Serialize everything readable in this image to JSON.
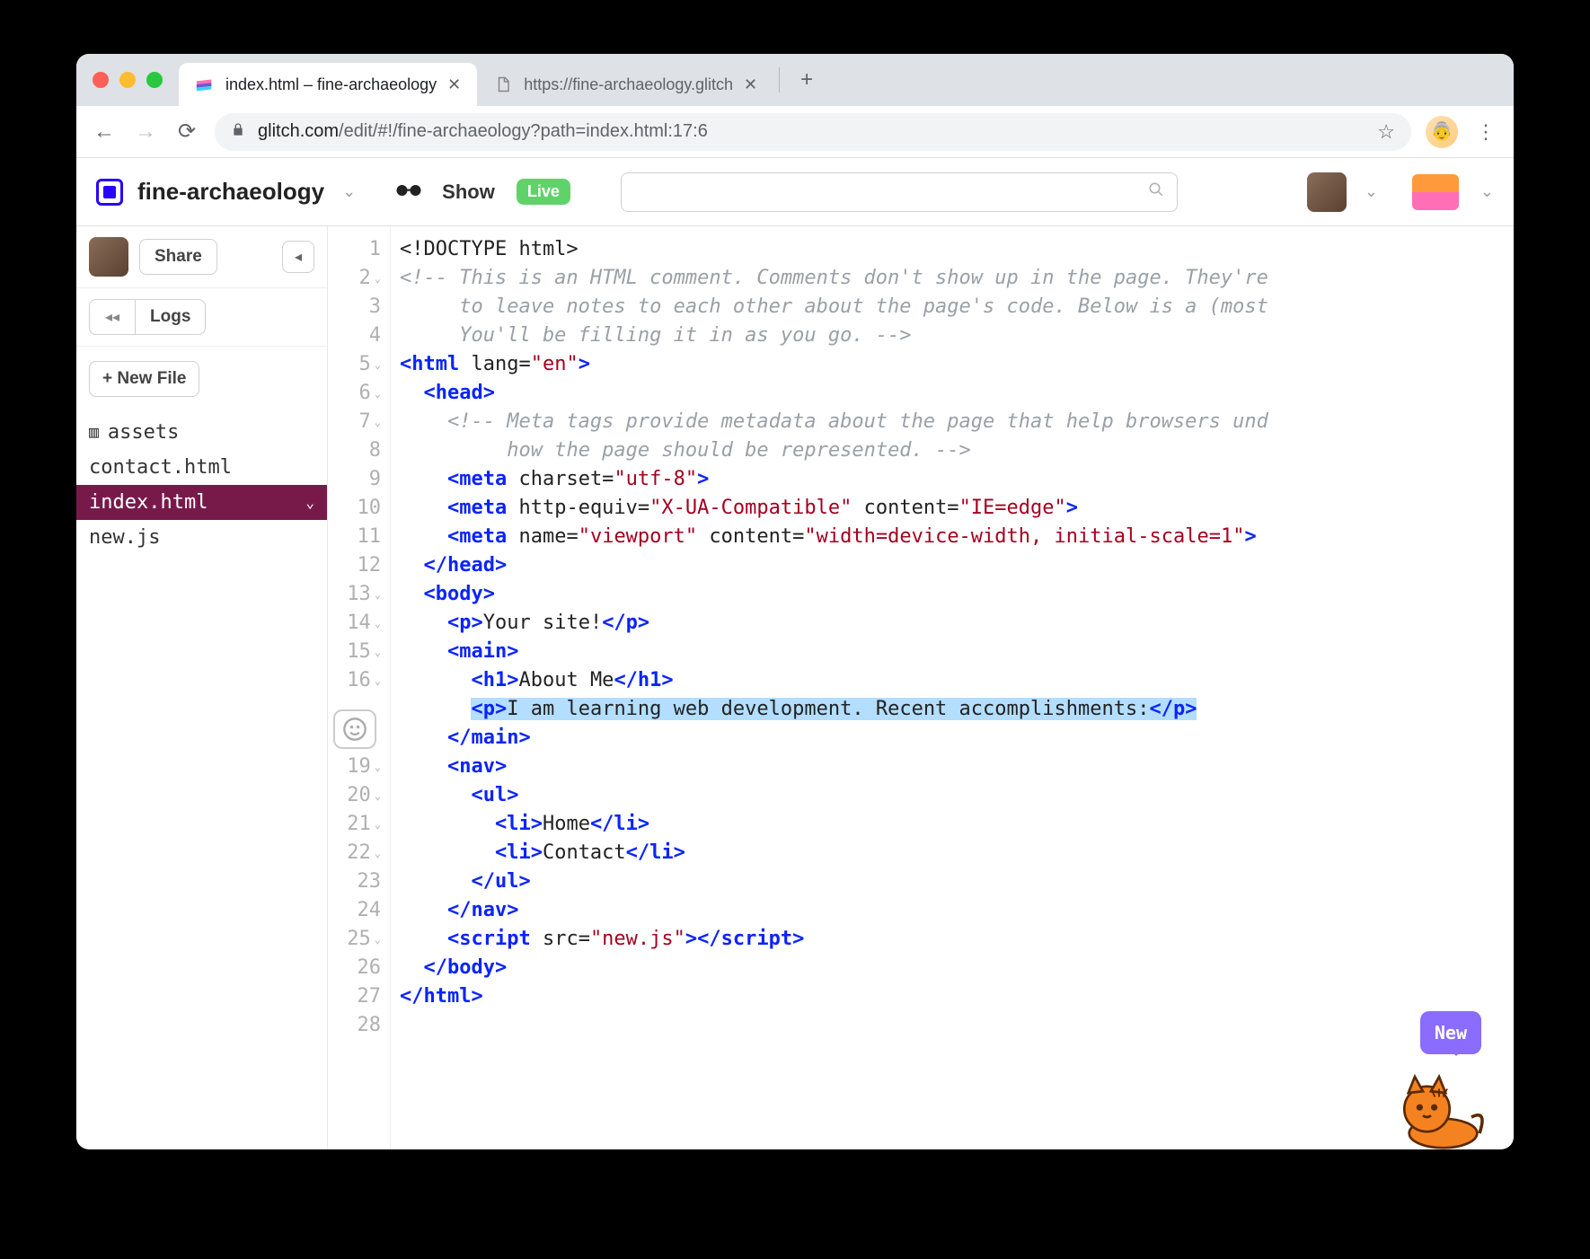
{
  "browser": {
    "tabs": [
      {
        "title": "index.html – fine-archaeology",
        "active": true
      },
      {
        "title": "https://fine-archaeology.glitch",
        "active": false
      }
    ],
    "url_domain": "glitch.com",
    "url_path": "/edit/#!/fine-archaeology?path=index.html:17:6"
  },
  "header": {
    "project_name": "fine-archaeology",
    "show_label": "Show",
    "live_label": "Live",
    "search_placeholder": ""
  },
  "sidebar": {
    "share_label": "Share",
    "logs_label": "Logs",
    "new_file_label": "+ New File",
    "files": [
      {
        "name": "assets",
        "icon": true,
        "active": false
      },
      {
        "name": "contact.html",
        "icon": false,
        "active": false
      },
      {
        "name": "index.html",
        "icon": false,
        "active": true
      },
      {
        "name": "new.js",
        "icon": false,
        "active": false
      }
    ]
  },
  "editor": {
    "lines": [
      {
        "n": 1,
        "fold": false,
        "html": "<span class='c-text'>&lt;!DOCTYPE html&gt;</span>"
      },
      {
        "n": 2,
        "fold": true,
        "html": "<span class='c-comment'>&lt;!-- This is an HTML comment. Comments don't show up in the page. They're</span>"
      },
      {
        "n": 3,
        "fold": false,
        "html": "<span class='c-comment'>     to leave notes to each other about the page's code. Below is a (most</span>"
      },
      {
        "n": 4,
        "fold": false,
        "html": "<span class='c-comment'>     You'll be filling it in as you go. --&gt;</span>"
      },
      {
        "n": 5,
        "fold": true,
        "html": "<span class='c-tag'>&lt;html</span> <span class='c-attr'>lang=</span><span class='c-str'>\"en\"</span><span class='c-tag'>&gt;</span>"
      },
      {
        "n": 6,
        "fold": true,
        "html": "  <span class='c-tag'>&lt;head&gt;</span>"
      },
      {
        "n": 7,
        "fold": true,
        "html": "    <span class='c-comment'>&lt;!-- Meta tags provide metadata about the page that help browsers und</span>"
      },
      {
        "n": 8,
        "fold": false,
        "html": "         <span class='c-comment'>how the page should be represented. --&gt;</span>"
      },
      {
        "n": 9,
        "fold": false,
        "html": "    <span class='c-tag'>&lt;meta</span> <span class='c-attr'>charset=</span><span class='c-str'>\"utf-8\"</span><span class='c-tag'>&gt;</span>"
      },
      {
        "n": 10,
        "fold": false,
        "html": "    <span class='c-tag'>&lt;meta</span> <span class='c-attr'>http-equiv=</span><span class='c-str'>\"X-UA-Compatible\"</span> <span class='c-attr'>content=</span><span class='c-str'>\"IE=edge\"</span><span class='c-tag'>&gt;</span>"
      },
      {
        "n": 11,
        "fold": false,
        "html": "    <span class='c-tag'>&lt;meta</span> <span class='c-attr'>name=</span><span class='c-str'>\"viewport\"</span> <span class='c-attr'>content=</span><span class='c-str'>\"width=device-width, initial-scale=1\"</span><span class='c-tag'>&gt;</span>"
      },
      {
        "n": 12,
        "fold": false,
        "html": "  <span class='c-tag'>&lt;/head&gt;</span>"
      },
      {
        "n": 13,
        "fold": true,
        "html": "  <span class='c-tag'>&lt;body&gt;</span>"
      },
      {
        "n": 14,
        "fold": true,
        "html": "    <span class='c-tag'>&lt;p&gt;</span><span class='c-text'>Your site!</span><span class='c-tag'>&lt;/p&gt;</span>"
      },
      {
        "n": 15,
        "fold": true,
        "html": "    <span class='c-tag'>&lt;main&gt;</span>"
      },
      {
        "n": 16,
        "fold": true,
        "html": "      <span class='c-tag'>&lt;h1&gt;</span><span class='c-text'>About Me</span><span class='c-tag'>&lt;/h1&gt;</span>"
      },
      {
        "n": "",
        "fold": false,
        "html": "      <span class='hl'><span class='c-tag'>&lt;p&gt;</span><span class='c-text'>I am learning web development. Recent accomplishments:</span><span class='c-tag'>&lt;/p&gt;</span></span>"
      },
      {
        "n": "",
        "fold": false,
        "html": "    <span class='c-tag'>&lt;/main&gt;</span>"
      },
      {
        "n": 19,
        "fold": true,
        "html": "    <span class='c-tag'>&lt;nav&gt;</span>"
      },
      {
        "n": 20,
        "fold": true,
        "html": "      <span class='c-tag'>&lt;ul&gt;</span>"
      },
      {
        "n": 21,
        "fold": true,
        "html": "        <span class='c-tag'>&lt;li&gt;</span><span class='c-text'>Home</span><span class='c-tag'>&lt;/li&gt;</span>"
      },
      {
        "n": 22,
        "fold": true,
        "html": "        <span class='c-tag'>&lt;li&gt;</span><span class='c-text'>Contact</span><span class='c-tag'>&lt;/li&gt;</span>"
      },
      {
        "n": 23,
        "fold": false,
        "html": "      <span class='c-tag'>&lt;/ul&gt;</span>"
      },
      {
        "n": 24,
        "fold": false,
        "html": "    <span class='c-tag'>&lt;/nav&gt;</span>"
      },
      {
        "n": 25,
        "fold": true,
        "html": "    <span class='c-tag'>&lt;script</span> <span class='c-attr'>src=</span><span class='c-str'>\"new.js\"</span><span class='c-tag'>&gt;&lt;/script&gt;</span>"
      },
      {
        "n": 26,
        "fold": false,
        "html": "  <span class='c-tag'>&lt;/body&gt;</span>"
      },
      {
        "n": 27,
        "fold": false,
        "html": "<span class='c-tag'>&lt;/html&gt;</span>"
      },
      {
        "n": 28,
        "fold": false,
        "html": ""
      }
    ]
  },
  "overlay": {
    "new_label": "New"
  }
}
